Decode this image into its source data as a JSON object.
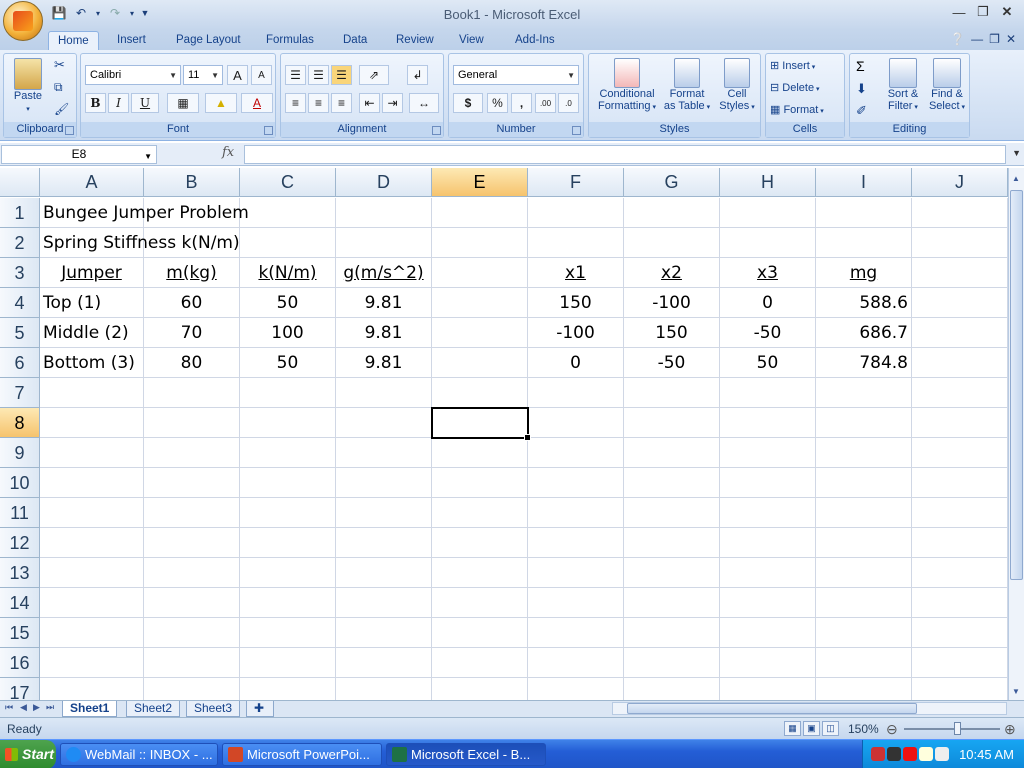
{
  "window": {
    "title": "Book1 - Microsoft Excel"
  },
  "ribbon_tabs": [
    "Home",
    "Insert",
    "Page Layout",
    "Formulas",
    "Data",
    "Review",
    "View",
    "Add-Ins"
  ],
  "ribbon": {
    "clipboard": {
      "label": "Clipboard",
      "paste": "Paste"
    },
    "font": {
      "label": "Font",
      "family": "Calibri",
      "size": "11",
      "bold": "B",
      "italic": "I",
      "underline": "U",
      "grow": "A",
      "shrink": "A"
    },
    "alignment": {
      "label": "Alignment"
    },
    "number": {
      "label": "Number",
      "format": "General",
      "currency": "$",
      "percent": "%",
      "comma": ","
    },
    "styles": {
      "label": "Styles",
      "conditional": "Conditional",
      "conditional2": "Formatting",
      "format_table": "Format",
      "format_table2": "as Table",
      "cell_styles": "Cell",
      "cell_styles2": "Styles"
    },
    "cells": {
      "label": "Cells",
      "insert": "Insert",
      "delete": "Delete",
      "format": "Format"
    },
    "editing": {
      "label": "Editing",
      "sort": "Sort &",
      "sort2": "Filter",
      "find": "Find &",
      "find2": "Select"
    }
  },
  "formula_bar": {
    "name_box": "E8",
    "fx": "fx",
    "value": ""
  },
  "columns": [
    "A",
    "B",
    "C",
    "D",
    "E",
    "F",
    "G",
    "H",
    "I",
    "J"
  ],
  "rows": [
    "1",
    "2",
    "3",
    "4",
    "5",
    "6",
    "7",
    "8",
    "9",
    "10",
    "11",
    "12",
    "13",
    "14",
    "15",
    "16",
    "17"
  ],
  "cells": {
    "A1": "Bungee Jumper Problem",
    "A2": "Spring Stiffness k(N/m)",
    "A3": "Jumper",
    "B3": "m(kg)",
    "C3": "k(N/m)",
    "D3": "g(m/s^2)",
    "F3": "x1",
    "G3": "x2",
    "H3": "x3",
    "I3": "mg",
    "A4": "Top (1)",
    "B4": "60",
    "C4": "50",
    "D4": "9.81",
    "F4": "150",
    "G4": "-100",
    "H4": "0",
    "I4": "588.6",
    "A5": "Middle (2)",
    "B5": "70",
    "C5": "100",
    "D5": "9.81",
    "F5": "-100",
    "G5": "150",
    "H5": "-50",
    "I5": "686.7",
    "A6": "Bottom (3)",
    "B6": "80",
    "C6": "50",
    "D6": "9.81",
    "F6": "0",
    "G6": "-50",
    "H6": "50",
    "I6": "784.8"
  },
  "sheets": [
    "Sheet1",
    "Sheet2",
    "Sheet3"
  ],
  "status": {
    "text": "Ready",
    "zoom": "150%"
  },
  "taskbar": {
    "start": "Start",
    "items": [
      "WebMail :: INBOX - ...",
      "Microsoft PowerPoi...",
      "Microsoft Excel - B..."
    ],
    "clock": "10:45 AM"
  }
}
